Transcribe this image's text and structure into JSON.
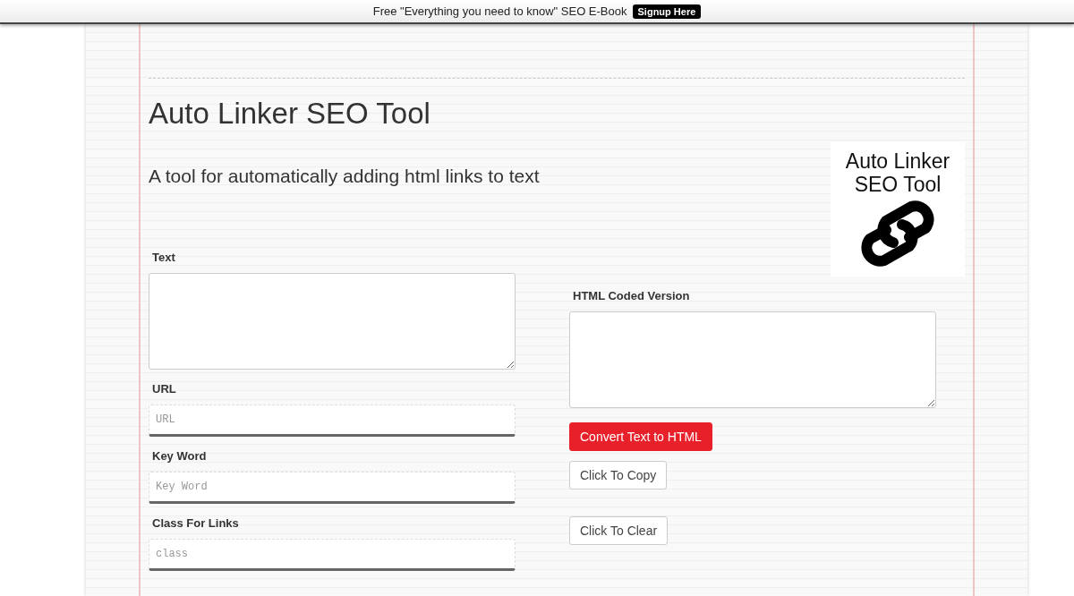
{
  "promo_bar": {
    "text": "Free \"Everything you need to know\" SEO E-Book",
    "button": "Signup Here"
  },
  "title": "Auto Linker SEO Tool",
  "subtitle": "A tool for automatically adding html links to text",
  "logo": {
    "lines": [
      "Auto Linker",
      "SEO Tool"
    ]
  },
  "left_fields": [
    {
      "kind": "textarea",
      "label": "Text"
    },
    {
      "kind": "input",
      "label": "URL",
      "placeholder": "URL"
    },
    {
      "kind": "input",
      "label": "Key Word",
      "placeholder": "Key Word"
    },
    {
      "kind": "input",
      "label": "Class For Links",
      "placeholder": "class"
    }
  ],
  "output": {
    "label": "HTML Coded Version"
  },
  "buttons": [
    {
      "kind": "primary",
      "label": "Convert Text to HTML"
    },
    {
      "kind": "plain",
      "label": "Click To Copy"
    },
    {
      "kind": "plain",
      "label": "Click To Clear"
    }
  ]
}
